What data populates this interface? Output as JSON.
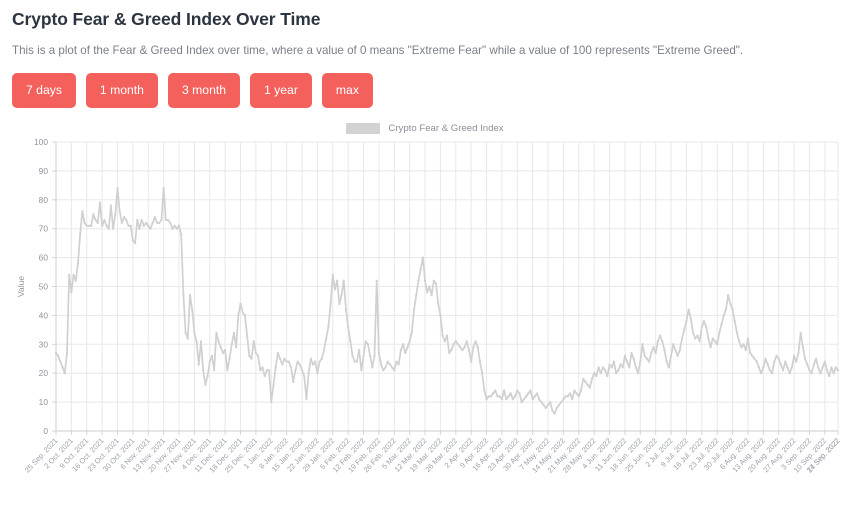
{
  "page": {
    "title": "Crypto Fear & Greed Index Over Time",
    "description": "This is a plot of the Fear & Greed Index over time, where a value of 0 means \"Extreme Fear\" while a value of 100 represents \"Extreme Greed\"."
  },
  "range_buttons": [
    {
      "id": "7-days",
      "label": "7 days"
    },
    {
      "id": "1-month",
      "label": "1 month"
    },
    {
      "id": "3-month",
      "label": "3 month"
    },
    {
      "id": "1-year",
      "label": "1 year"
    },
    {
      "id": "max",
      "label": "max"
    }
  ],
  "colors": {
    "button_background": "#f4605c",
    "button_text": "#ffffff",
    "series_line": "#d0d0d0",
    "legend_swatch": "#d2d2d2",
    "gridline": "#e8e8e8",
    "axis_line": "#d6d6d6",
    "title_text": "#2c3440",
    "body_text": "#7b7f8a",
    "tick_text": "#8e939d"
  },
  "chart_data": {
    "type": "line",
    "title": "",
    "xlabel": "",
    "ylabel": "Value",
    "ylim": [
      0,
      100
    ],
    "ytick_step": 10,
    "yticks": [
      0,
      10,
      20,
      30,
      40,
      50,
      60,
      70,
      80,
      90,
      100
    ],
    "grid": true,
    "legend_position": "top-center",
    "x_start": "25 Sep. 2021",
    "x_end": "24 Sep. 2022",
    "x_tick_interval_days": 7,
    "xticks": [
      "25 Sep. 2021",
      "2 Oct. 2021",
      "9 Oct. 2021",
      "16 Oct. 2021",
      "23 Oct. 2021",
      "30 Oct. 2021",
      "6 Nov. 2021",
      "13 Nov. 2021",
      "20 Nov. 2021",
      "27 Nov. 2021",
      "4 Dec. 2021",
      "11 Dec. 2021",
      "18 Dec. 2021",
      "25 Dec. 2021",
      "1 Jan. 2022",
      "8 Jan. 2022",
      "15 Jan. 2022",
      "22 Jan. 2022",
      "29 Jan. 2022",
      "5 Feb. 2022",
      "12 Feb. 2022",
      "19 Feb. 2022",
      "26 Feb. 2022",
      "5 Mar. 2022",
      "12 Mar. 2022",
      "19 Mar. 2022",
      "26 Mar. 2022",
      "2 Apr. 2022",
      "9 Apr. 2022",
      "16 Apr. 2022",
      "23 Apr. 2022",
      "30 Apr. 2022",
      "7 May. 2022",
      "14 May. 2022",
      "21 May. 2022",
      "28 May. 2022",
      "4 Jun. 2022",
      "11 Jun. 2022",
      "18 Jun. 2022",
      "25 Jun. 2022",
      "2 Jul. 2022",
      "9 Jul. 2022",
      "16 Jul. 2022",
      "23 Jul. 2022",
      "30 Jul. 2022",
      "6 Aug. 2022",
      "13 Aug. 2022",
      "20 Aug. 2022",
      "27 Aug. 2022",
      "3 Sep. 2022",
      "10 Sep. 2022",
      "17 Sep. 2022",
      "24 Sep. 2022"
    ],
    "series": [
      {
        "name": "Crypto Fear & Greed Index",
        "color": "#d0d0d0",
        "values": [
          27,
          26,
          24,
          22,
          20,
          27,
          54,
          48,
          54,
          52,
          58,
          68,
          76,
          72,
          71,
          71,
          71,
          75,
          73,
          72,
          79,
          71,
          73,
          71,
          70,
          78,
          70,
          75,
          84,
          76,
          72,
          74,
          73,
          71,
          71,
          66,
          65,
          73,
          70,
          73,
          71,
          72,
          71,
          70,
          72,
          74,
          72,
          72,
          73,
          84,
          73,
          73,
          72,
          70,
          71,
          70,
          71,
          68,
          47,
          34,
          32,
          47,
          42,
          34,
          31,
          23,
          31,
          21,
          16,
          19,
          24,
          26,
          21,
          34,
          31,
          29,
          27,
          28,
          21,
          25,
          30,
          34,
          29,
          40,
          44,
          41,
          40,
          33,
          26,
          25,
          31,
          27,
          26,
          21,
          22,
          19,
          21,
          21,
          10,
          16,
          22,
          27,
          25,
          23,
          25,
          24,
          24,
          22,
          17,
          21,
          24,
          23,
          21,
          19,
          11,
          20,
          25,
          23,
          24,
          20,
          24,
          25,
          28,
          32,
          36,
          44,
          54,
          49,
          52,
          44,
          47,
          52,
          42,
          36,
          31,
          26,
          24,
          24,
          28,
          21,
          26,
          31,
          30,
          26,
          22,
          26,
          52,
          27,
          23,
          21,
          22,
          24,
          23,
          22,
          21,
          24,
          23,
          28,
          30,
          27,
          29,
          31,
          34,
          42,
          47,
          52,
          56,
          60,
          52,
          48,
          50,
          47,
          52,
          51,
          44,
          40,
          33,
          31,
          33,
          27,
          28,
          30,
          31,
          30,
          29,
          28,
          29,
          31,
          28,
          24,
          29,
          31,
          29,
          24,
          20,
          14,
          11,
          12,
          12,
          13,
          14,
          12,
          12,
          11,
          14,
          11,
          12,
          13,
          11,
          12,
          14,
          13,
          10,
          11,
          12,
          13,
          14,
          11,
          12,
          13,
          11,
          10,
          9,
          8,
          9,
          10,
          7,
          6,
          8,
          9,
          10,
          11,
          12,
          12,
          13,
          11,
          14,
          13,
          12,
          14,
          18,
          17,
          16,
          15,
          18,
          20,
          19,
          22,
          20,
          22,
          21,
          19,
          23,
          22,
          24,
          20,
          21,
          23,
          22,
          26,
          24,
          22,
          27,
          25,
          22,
          20,
          24,
          30,
          26,
          25,
          24,
          27,
          29,
          27,
          31,
          33,
          31,
          28,
          24,
          22,
          26,
          30,
          28,
          26,
          28,
          32,
          35,
          38,
          42,
          39,
          34,
          32,
          33,
          31,
          36,
          38,
          36,
          32,
          29,
          32,
          31,
          30,
          34,
          37,
          40,
          42,
          47,
          44,
          42,
          38,
          34,
          31,
          29,
          30,
          28,
          32,
          27,
          26,
          25,
          24,
          22,
          20,
          22,
          25,
          23,
          21,
          20,
          24,
          26,
          25,
          23,
          21,
          24,
          22,
          20,
          22,
          26,
          24,
          27,
          34,
          29,
          25,
          23,
          21,
          20,
          23,
          25,
          22,
          20,
          22,
          24,
          21,
          19,
          22,
          20,
          22,
          21
        ]
      }
    ]
  }
}
